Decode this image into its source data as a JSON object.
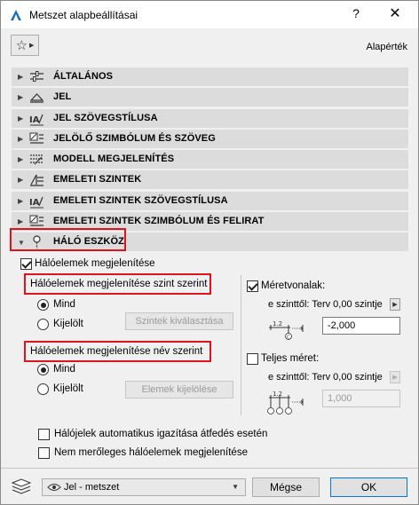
{
  "window": {
    "title": "Metszet alapbeállításai",
    "help_label": "?",
    "close_label": "✕"
  },
  "toolbar": {
    "defaults_label": "Alapérték"
  },
  "sections": [
    {
      "label": "ÁLTALÁNOS",
      "icon": "general-settings-icon"
    },
    {
      "label": "JEL",
      "icon": "marker-icon"
    },
    {
      "label": "JEL SZÖVEGSTÍLUSA",
      "icon": "text-style-icon"
    },
    {
      "label": "JELÖLŐ SZIMBÓLUM ÉS SZÖVEG",
      "icon": "symbol-text-icon"
    },
    {
      "label": "MODELL MEGJELENÍTÉS",
      "icon": "model-display-icon"
    },
    {
      "label": "EMELETI SZINTEK",
      "icon": "story-levels-icon"
    },
    {
      "label": "EMELETI SZINTEK SZÖVEGSTÍLUSA",
      "icon": "text-style-icon"
    },
    {
      "label": "EMELETI SZINTEK SZIMBÓLUM ÉS FELIRAT",
      "icon": "symbol-text-icon"
    },
    {
      "label": "HÁLÓ ESZKÖZ",
      "icon": "grid-tool-icon"
    }
  ],
  "grid_tool": {
    "show_grid_elements": "Hálóelemek megjelenítése",
    "by_story": {
      "heading": "Hálóelemek megjelenítése szint szerint",
      "option_all": "Mind",
      "option_selected": "Kijelölt",
      "select_button": "Szintek kiválasztása"
    },
    "by_name": {
      "heading": "Hálóelemek megjelenítése név szerint",
      "option_all": "Mind",
      "option_selected": "Kijelölt",
      "select_button": "Elemek kijelölése"
    },
    "dimension_lines": {
      "label": "Méretvonalak:",
      "offset_label": "e szinttől: Terv 0,00 szintje",
      "value": "-2,000"
    },
    "full_size": {
      "label": "Teljes méret:",
      "offset_label": "e szinttől: Terv 0,00 szintje",
      "value": "1,000"
    },
    "auto_align": "Hálójelek automatikus igazítása átfedés esetén",
    "non_orthogonal": "Nem merőleges hálóelemek megjelenítése"
  },
  "footer": {
    "view_dropdown": "Jel - metszet",
    "cancel": "Mégse",
    "ok": "OK"
  }
}
